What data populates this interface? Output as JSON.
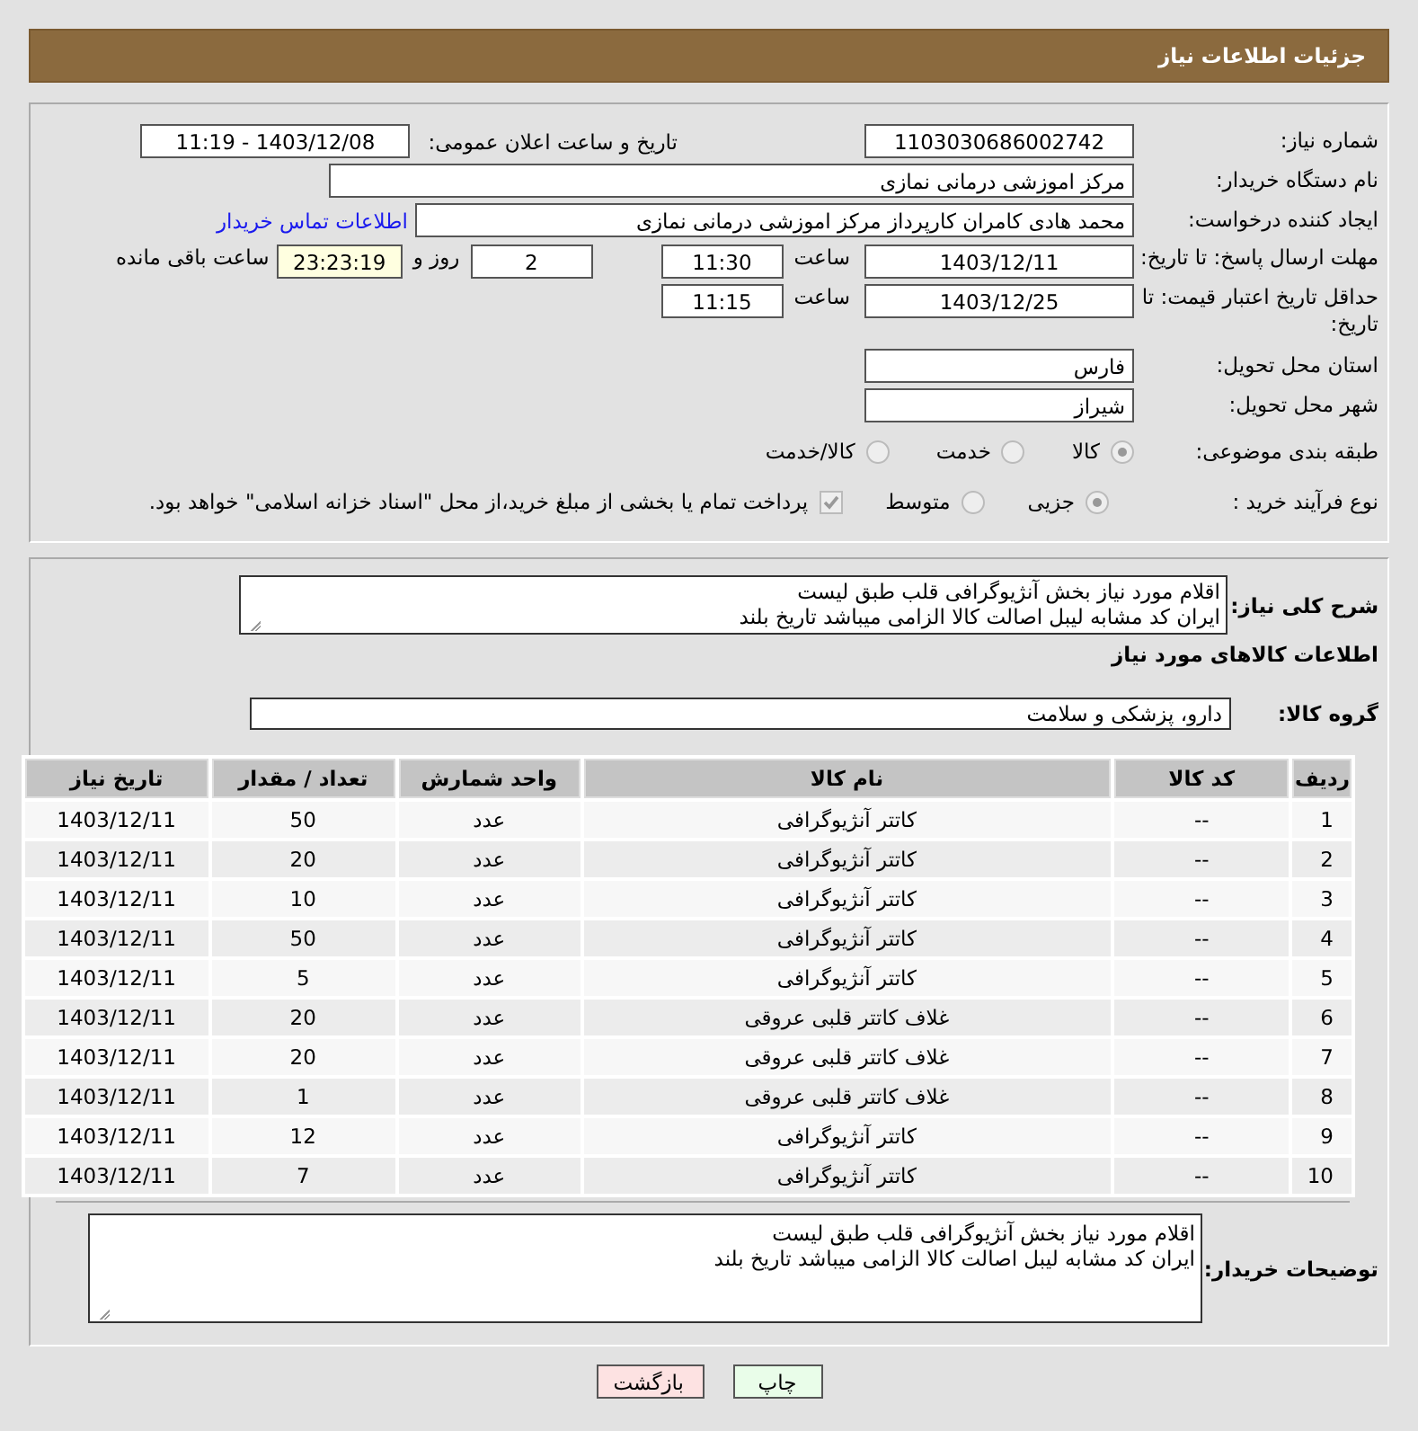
{
  "header": {
    "title": "جزئیات اطلاعات نیاز"
  },
  "info": {
    "need_number": {
      "label": "شماره نیاز:",
      "value": "1103030686002742"
    },
    "announce": {
      "label": "تاریخ و ساعت اعلان عمومی:",
      "value": "1403/12/08 - 11:19"
    },
    "buyer_org": {
      "label": "نام دستگاه خریدار:",
      "value": "مرکز اموزشی درمانی نمازی"
    },
    "requester": {
      "label": "ایجاد کننده درخواست:",
      "value": "محمد هادی کامران کارپرداز مرکز اموزشی درمانی نمازی",
      "link": "اطلاعات تماس خریدار"
    },
    "deadline": {
      "label": "مهلت ارسال پاسخ: تا تاریخ:",
      "date": "1403/12/11",
      "time_label": "ساعت",
      "time": "11:30",
      "days": "2",
      "days_label": "روز و",
      "remaining": "23:23:19",
      "remaining_label": "ساعت باقی مانده"
    },
    "validity": {
      "label": "حداقل تاریخ اعتبار قیمت: تا تاریخ:",
      "date": "1403/12/25",
      "time_label": "ساعت",
      "time": "11:15"
    },
    "province": {
      "label": "استان محل تحویل:",
      "value": "فارس"
    },
    "city": {
      "label": "شهر محل تحویل:",
      "value": "شیراز"
    },
    "category": {
      "label": "طبقه بندی موضوعی:",
      "options": [
        {
          "label": "کالا",
          "selected": true
        },
        {
          "label": "خدمت",
          "selected": false
        },
        {
          "label": "کالا/خدمت",
          "selected": false
        }
      ]
    },
    "process": {
      "label": "نوع فرآیند خرید :",
      "options": [
        {
          "label": "جزیی",
          "selected": true
        },
        {
          "label": "متوسط",
          "selected": false
        }
      ],
      "payment": {
        "label": "پرداخت تمام یا بخشی از مبلغ خرید،از محل \"اسناد خزانه اسلامی\" خواهد بود.",
        "checked": true
      }
    }
  },
  "goods": {
    "description": {
      "label": "شرح کلی نیاز:",
      "lines": [
        "اقلام مورد نیاز بخش آنژیوگرافی قلب طبق لیست",
        "ایران کد مشابه لیبل اصالت کالا الزامی میباشد تاریخ بلند"
      ]
    },
    "title": "اطلاعات کالاهای مورد نیاز",
    "group": {
      "label": "گروه کالا:",
      "value": "دارو، پزشکی و سلامت"
    },
    "table": {
      "columns": [
        "ردیف",
        "کد کالا",
        "نام کالا",
        "واحد شمارش",
        "تعداد / مقدار",
        "تاریخ نیاز"
      ],
      "rows": [
        [
          "1",
          "--",
          "کاتتر آنژیوگرافی",
          "عدد",
          "50",
          "1403/12/11"
        ],
        [
          "2",
          "--",
          "کاتتر آنژیوگرافی",
          "عدد",
          "20",
          "1403/12/11"
        ],
        [
          "3",
          "--",
          "کاتتر آنژیوگرافی",
          "عدد",
          "10",
          "1403/12/11"
        ],
        [
          "4",
          "--",
          "کاتتر آنژیوگرافی",
          "عدد",
          "50",
          "1403/12/11"
        ],
        [
          "5",
          "--",
          "کاتتر آنژیوگرافی",
          "عدد",
          "5",
          "1403/12/11"
        ],
        [
          "6",
          "--",
          "غلاف کاتتر قلبی عروقی",
          "عدد",
          "20",
          "1403/12/11"
        ],
        [
          "7",
          "--",
          "غلاف کاتتر قلبی عروقی",
          "عدد",
          "20",
          "1403/12/11"
        ],
        [
          "8",
          "--",
          "غلاف کاتتر قلبی عروقی",
          "عدد",
          "1",
          "1403/12/11"
        ],
        [
          "9",
          "--",
          "کاتتر آنژیوگرافی",
          "عدد",
          "12",
          "1403/12/11"
        ],
        [
          "10",
          "--",
          "کاتتر آنژیوگرافی",
          "عدد",
          "7",
          "1403/12/11"
        ]
      ]
    },
    "buyer_notes": {
      "label": "توضیحات خریدار:",
      "lines": [
        "اقلام مورد نیاز بخش آنژیوگرافی قلب طبق لیست",
        "ایران کد مشابه لیبل اصالت کالا الزامی میباشد تاریخ بلند"
      ]
    }
  },
  "buttons": [
    {
      "label": "چاپ",
      "kind": "print"
    },
    {
      "label": "بازگشت",
      "kind": "back"
    }
  ]
}
